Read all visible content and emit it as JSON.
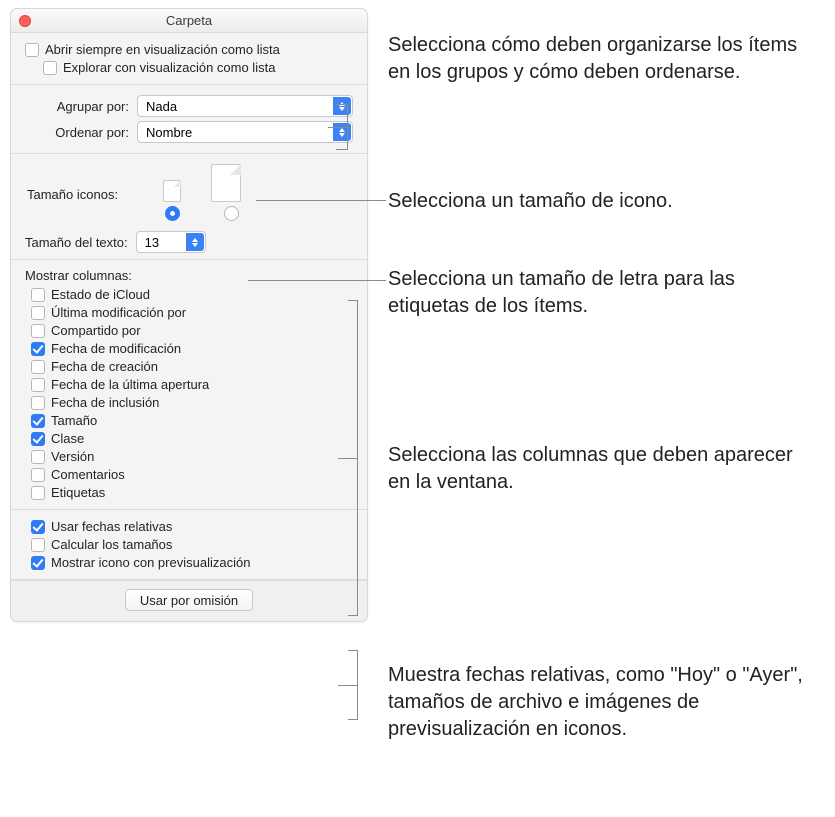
{
  "window": {
    "title": "Carpeta"
  },
  "top_options": {
    "always_open_list": {
      "label": "Abrir siempre en visualización como lista",
      "checked": false
    },
    "browse_list": {
      "label": "Explorar con visualización como lista",
      "checked": false,
      "disabled": true
    }
  },
  "grouping": {
    "group_by_label": "Agrupar por:",
    "group_by_value": "Nada",
    "sort_by_label": "Ordenar por:",
    "sort_by_value": "Nombre"
  },
  "icon_size": {
    "label": "Tamaño iconos:",
    "selected": "small"
  },
  "text_size": {
    "label": "Tamaño del texto:",
    "value": "13"
  },
  "columns": {
    "header": "Mostrar columnas:",
    "items": [
      {
        "label": "Estado de iCloud",
        "checked": false
      },
      {
        "label": "Última modificación por",
        "checked": false
      },
      {
        "label": "Compartido por",
        "checked": false
      },
      {
        "label": "Fecha de modificación",
        "checked": true
      },
      {
        "label": "Fecha de creación",
        "checked": false
      },
      {
        "label": "Fecha de la última apertura",
        "checked": false
      },
      {
        "label": "Fecha de inclusión",
        "checked": false
      },
      {
        "label": "Tamaño",
        "checked": true
      },
      {
        "label": "Clase",
        "checked": true
      },
      {
        "label": "Versión",
        "checked": false
      },
      {
        "label": "Comentarios",
        "checked": false
      },
      {
        "label": "Etiquetas",
        "checked": false
      }
    ]
  },
  "bottom_options": {
    "items": [
      {
        "label": "Usar fechas relativas",
        "checked": true
      },
      {
        "label": "Calcular los tamaños",
        "checked": false
      },
      {
        "label": "Mostrar icono con previsualización",
        "checked": true
      }
    ]
  },
  "footer": {
    "defaults_button": "Usar por omisión"
  },
  "callouts": {
    "grouping": "Selecciona cómo deben organizarse los ítems en los grupos y cómo deben ordenarse.",
    "icon_size": "Selecciona un tamaño de icono.",
    "text_size": "Selecciona un tamaño de letra para las etiquetas de los ítems.",
    "columns": "Selecciona las columnas que deben aparecer en la ventana.",
    "bottom": "Muestra fechas relativas, como \"Hoy\" o \"Ayer\", tamaños de archivo e imágenes de previsualización en iconos."
  }
}
